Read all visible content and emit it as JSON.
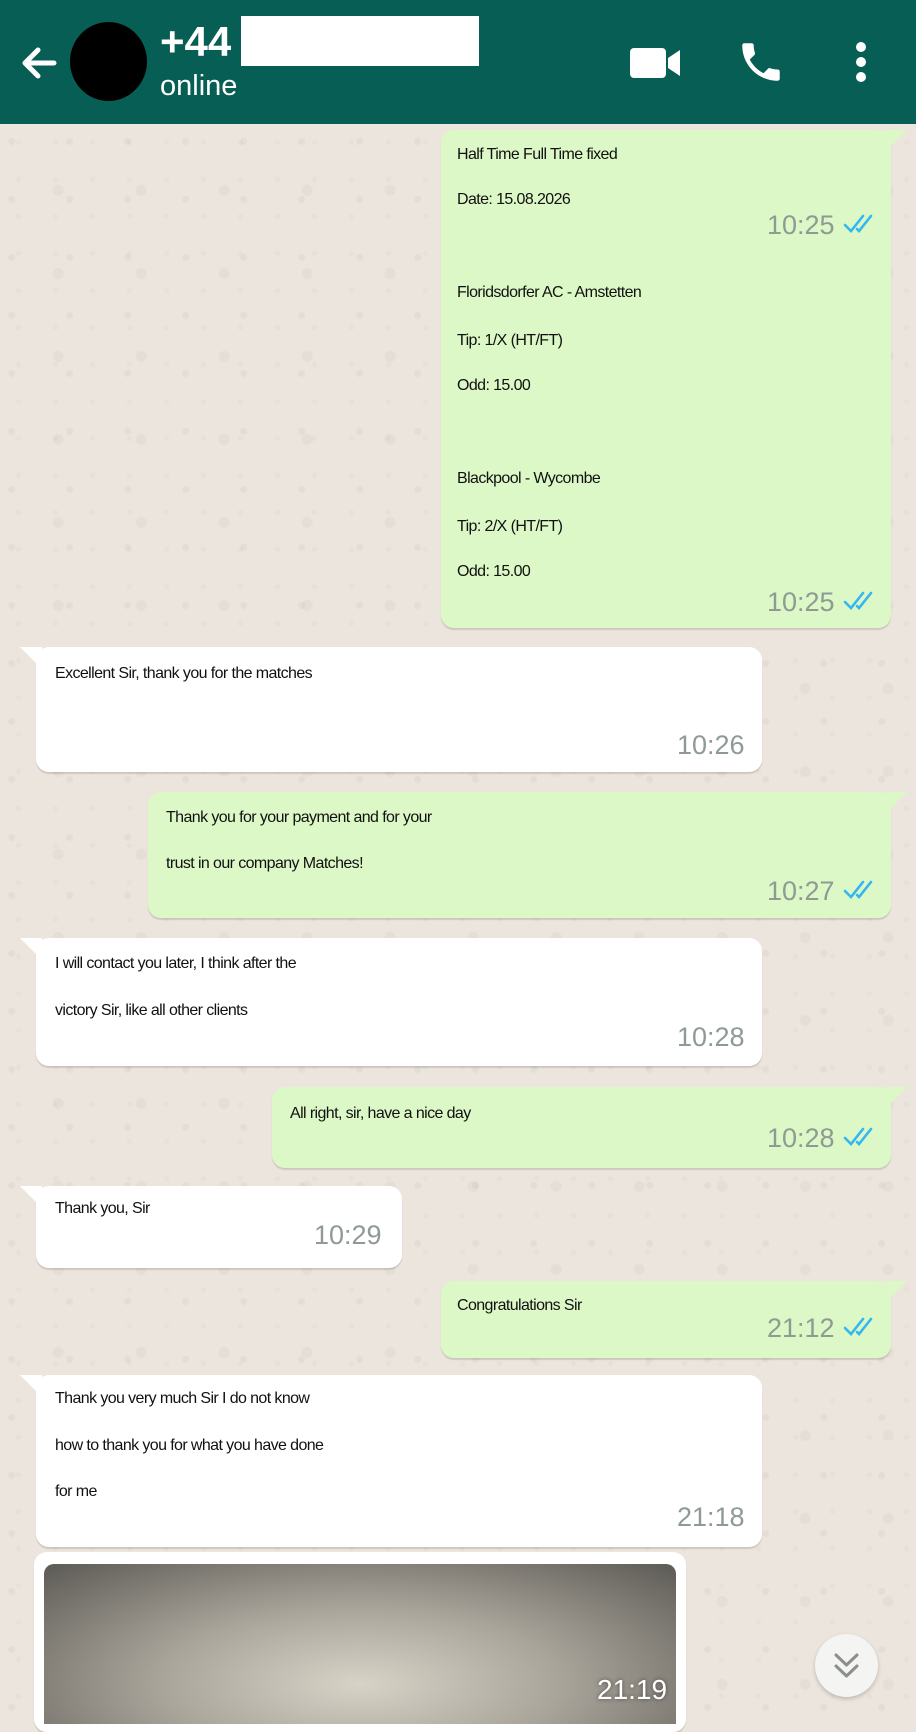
{
  "header": {
    "contact_name": "+44",
    "status": "online",
    "colors": {
      "bar": "#075e54",
      "icon": "#ffffff"
    },
    "icons": [
      "back-arrow-icon",
      "video-call-icon",
      "phone-icon",
      "more-vert-icon"
    ]
  },
  "messages": [
    {
      "direction": "out",
      "lines": [
        "Half Time Full Time fixed",
        "Date: 15.08.2026"
      ],
      "time": "10:25"
    },
    {
      "direction": "out",
      "lines": [
        "Floridsdorfer AC - Amstetten",
        "Tip: 1/X (HT/FT)",
        "Odd: 15.00",
        "",
        "Blackpool - Wycombe",
        "Tip: 2/X (HT/FT)",
        "Odd: 15.00"
      ],
      "time": "10:25"
    },
    {
      "direction": "in",
      "lines": [
        "Excellent Sir, thank you for the matches"
      ],
      "time": "10:26"
    },
    {
      "direction": "out",
      "lines": [
        "Thank you for your payment and for your",
        "trust in our company Matches!"
      ],
      "time": "10:27"
    },
    {
      "direction": "in",
      "lines": [
        "I will contact you later, I think after the",
        "victory Sir, like all other clients"
      ],
      "time": "10:28"
    },
    {
      "direction": "out",
      "lines": [
        "All right, sir, have a nice day"
      ],
      "time": "10:28"
    },
    {
      "direction": "in",
      "lines": [
        "Thank you, Sir"
      ],
      "time": "10:29"
    },
    {
      "direction": "out",
      "lines": [
        "Congratulations Sir"
      ],
      "time": "21:12"
    },
    {
      "direction": "in",
      "lines": [
        "Thank you very much Sir I do not know",
        "how to thank you for what you have done",
        "for me"
      ],
      "time": "21:18"
    },
    {
      "direction": "in",
      "type": "image",
      "time": "21:19"
    }
  ],
  "colors": {
    "outgoing_bubble": "#dcf8c6",
    "incoming_bubble": "#ffffff",
    "read_ticks": "#34b7f1",
    "chat_background": "#ece5dd"
  },
  "scroll_button_icon": "double-chevron-down-icon"
}
